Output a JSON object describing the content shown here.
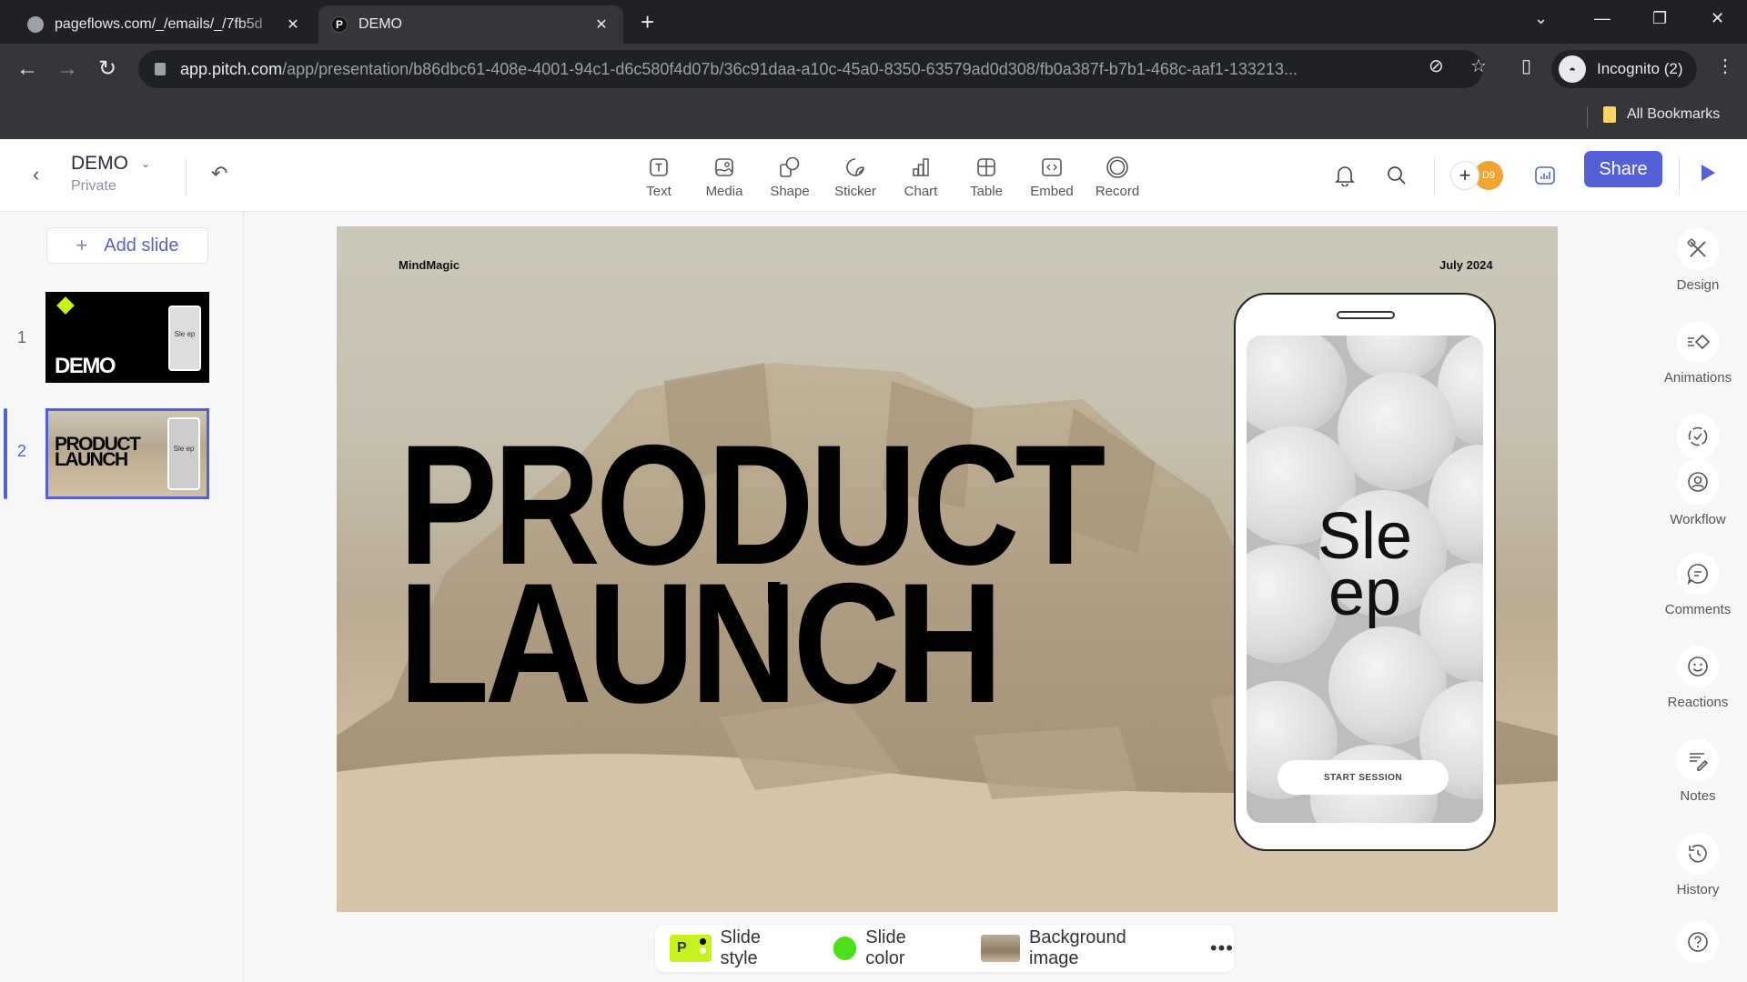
{
  "browser": {
    "tabs": [
      {
        "title": "pageflows.com/_/emails/_/7fb5d",
        "active": false
      },
      {
        "title": "DEMO",
        "active": true
      }
    ],
    "new_tab": "+",
    "url_host": "app.pitch.com",
    "url_path": "/app/presentation/b86dbc61-408e-4001-94c1-d6c580f4d07b/36c91daa-a10c-45a0-8350-63579ad0d308/fb0a387f-b7b1-468c-aaf1-133213...",
    "profile_label": "Incognito (2)",
    "bookmarks_label": "All Bookmarks"
  },
  "header": {
    "doc_title": "DEMO",
    "doc_visibility": "Private",
    "tools": [
      {
        "label": "Text",
        "icon": "text-icon"
      },
      {
        "label": "Media",
        "icon": "media-icon"
      },
      {
        "label": "Shape",
        "icon": "shape-icon"
      },
      {
        "label": "Sticker",
        "icon": "sticker-icon"
      },
      {
        "label": "Chart",
        "icon": "chart-icon"
      },
      {
        "label": "Table",
        "icon": "table-icon"
      },
      {
        "label": "Embed",
        "icon": "embed-icon"
      },
      {
        "label": "Record",
        "icon": "record-icon"
      }
    ],
    "avatar_initials": "D9",
    "share_label": "Share",
    "accent_color": "#5461d6"
  },
  "slides_panel": {
    "add_slide_label": "Add slide",
    "slides": [
      {
        "number": "1",
        "title": "DEMO",
        "phone_text": "Sle ep"
      },
      {
        "number": "2",
        "title_line1": "PRODUCT",
        "title_line2": "LAUNCH",
        "phone_text": "Sle ep",
        "selected": true
      }
    ]
  },
  "slide": {
    "brand": "MindMagic",
    "date": "July 2024",
    "title_line1": "PRODUCT",
    "title_line2": "LAUNCH",
    "phone_title_line1": "Sle",
    "phone_title_line2": "ep",
    "phone_button": "START SESSION"
  },
  "right_rail": [
    {
      "label": "Design",
      "icon": "design-icon"
    },
    {
      "label": "Animations",
      "icon": "animations-icon"
    },
    {
      "label": "Workflow",
      "icon": "workflow-icon"
    },
    {
      "label": "Comments",
      "icon": "comments-icon"
    },
    {
      "label": "Reactions",
      "icon": "reactions-icon"
    },
    {
      "label": "Notes",
      "icon": "notes-icon"
    },
    {
      "label": "History",
      "icon": "history-icon"
    }
  ],
  "bottom_bar": {
    "slide_style_label": "Slide style",
    "slide_style_badge": "P",
    "slide_color_label": "Slide color",
    "slide_color": "#4ce01a",
    "background_image_label": "Background image",
    "more_label": "•••"
  }
}
